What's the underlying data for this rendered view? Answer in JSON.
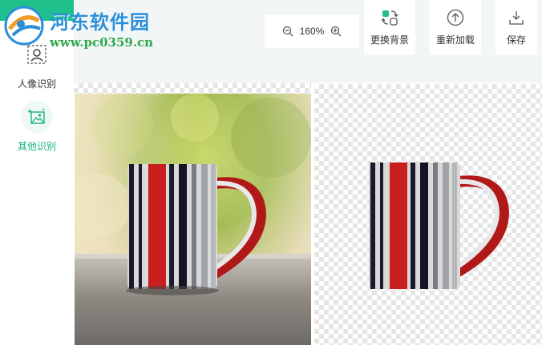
{
  "watermark": {
    "title": "河东软件园",
    "url": "www.pc0359.cn"
  },
  "sidebar": {
    "items": [
      {
        "label": "人像识别",
        "icon": "portrait-scan-icon",
        "active": false
      },
      {
        "label": "其他识别",
        "icon": "image-sparkle-icon",
        "active": true
      }
    ]
  },
  "toolbar": {
    "zoom": "160%",
    "change_bg_label": "更换背景",
    "reload_label": "重新加载",
    "save_label": "保存"
  },
  "colors": {
    "accent": "#20c08c",
    "accent_text": "#16b47e",
    "topbar_bg": "#f3f6f6",
    "watermark_blue": "#2a8fd8",
    "watermark_green": "#2fa84a"
  },
  "images": {
    "original": "cup-photo-original",
    "result": "cup-photo-background-removed"
  }
}
